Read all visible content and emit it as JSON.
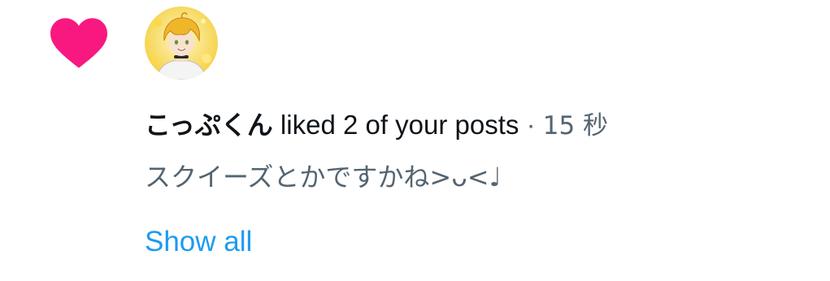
{
  "notification": {
    "user_name": "こっぷくん",
    "action_text": " liked 2 of your posts",
    "separator": " · ",
    "timestamp": "15 秒",
    "post_snippet": "スクイーズとかですかね>ᴗ<♩",
    "show_all_label": "Show all"
  },
  "icons": {
    "like": "heart-icon",
    "avatar": "user-avatar"
  },
  "colors": {
    "heart": "#f91880",
    "link": "#1d9bf0",
    "primary_text": "#0f1419",
    "secondary_text": "#536471"
  }
}
